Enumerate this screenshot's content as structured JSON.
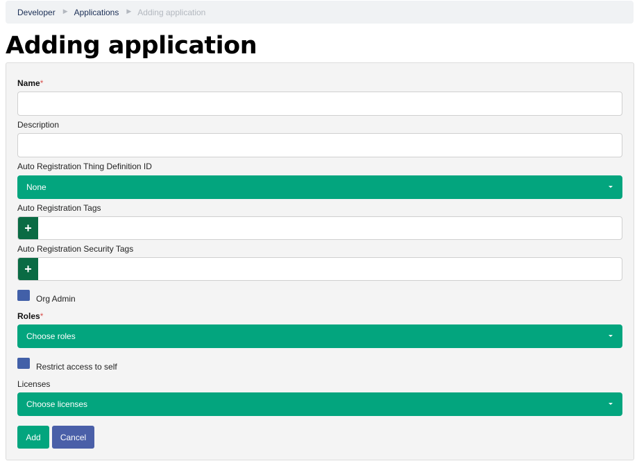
{
  "breadcrumb": {
    "items": [
      "Developer",
      "Applications",
      "Adding application"
    ]
  },
  "page": {
    "title": "Adding application"
  },
  "form": {
    "name": {
      "label": "Name",
      "required_mark": "*",
      "value": "",
      "placeholder": ""
    },
    "description": {
      "label": "Description",
      "value": "",
      "placeholder": ""
    },
    "thing_definition": {
      "label": "Auto Registration Thing Definition ID",
      "selected": "None"
    },
    "tags": {
      "label": "Auto Registration Tags",
      "add_symbol": "+"
    },
    "security_tags": {
      "label": "Auto Registration Security Tags",
      "add_symbol": "+"
    },
    "org_admin": {
      "label": "Org Admin"
    },
    "roles": {
      "label": "Roles",
      "required_mark": "*",
      "selected": "Choose roles"
    },
    "restrict_access": {
      "label": "Restrict access to self"
    },
    "licenses": {
      "label": "Licenses",
      "selected": "Choose licenses"
    },
    "buttons": {
      "add": "Add",
      "cancel": "Cancel"
    }
  },
  "colors": {
    "accent_green": "#03a57e",
    "dark_green": "#0a6b44",
    "checkbox_blue": "#4260a8",
    "cancel_blue": "#4a5fa8",
    "required_red": "#d9534f"
  },
  "icons": [
    "breadcrumb-separator-icon",
    "caret-down-icon",
    "plus-icon"
  ]
}
